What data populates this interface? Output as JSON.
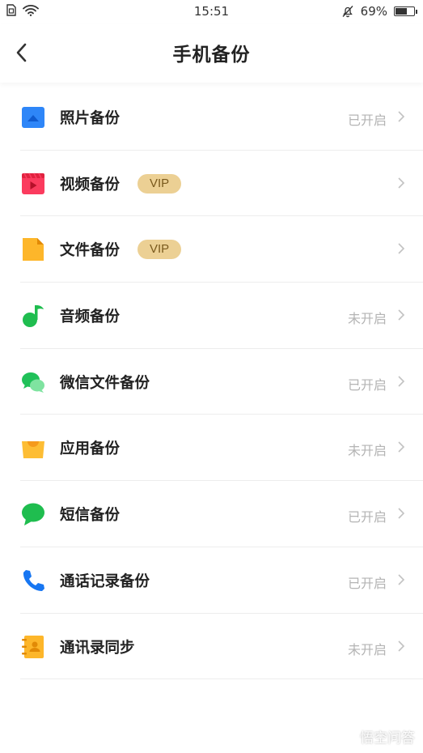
{
  "status_bar": {
    "time": "15:51",
    "battery": "69%",
    "battery_level": 0.69,
    "icons": [
      "sim-icon",
      "wifi-icon",
      "mute-bell-icon",
      "battery-icon"
    ]
  },
  "header": {
    "title": "手机备份",
    "back_icon": "chevron-left-icon"
  },
  "items": [
    {
      "label": "照片备份",
      "vip": "",
      "status": "已开启",
      "icon": "photo-icon",
      "color": "#2e86f8"
    },
    {
      "label": "视频备份",
      "vip": "VIP",
      "status": "",
      "icon": "video-icon",
      "color": "#fb3b5e"
    },
    {
      "label": "文件备份",
      "vip": "VIP",
      "status": "",
      "icon": "file-icon",
      "color": "#fdb62a"
    },
    {
      "label": "音频备份",
      "vip": "",
      "status": "未开启",
      "icon": "music-note-icon",
      "color": "#1fbd4f"
    },
    {
      "label": "微信文件备份",
      "vip": "",
      "status": "已开启",
      "icon": "wechat-icon",
      "color": "#20c159"
    },
    {
      "label": "应用备份",
      "vip": "",
      "status": "未开启",
      "icon": "shopping-bag-icon",
      "color": "#fdbd34"
    },
    {
      "label": "短信备份",
      "vip": "",
      "status": "已开启",
      "icon": "message-bubble-icon",
      "color": "#1fbd4f"
    },
    {
      "label": "通话记录备份",
      "vip": "",
      "status": "已开启",
      "icon": "phone-icon",
      "color": "#1776f2"
    },
    {
      "label": "通讯录同步",
      "vip": "",
      "status": "未开启",
      "icon": "contacts-icon",
      "color": "#fdb62a"
    }
  ],
  "watermark": "悟空问答"
}
